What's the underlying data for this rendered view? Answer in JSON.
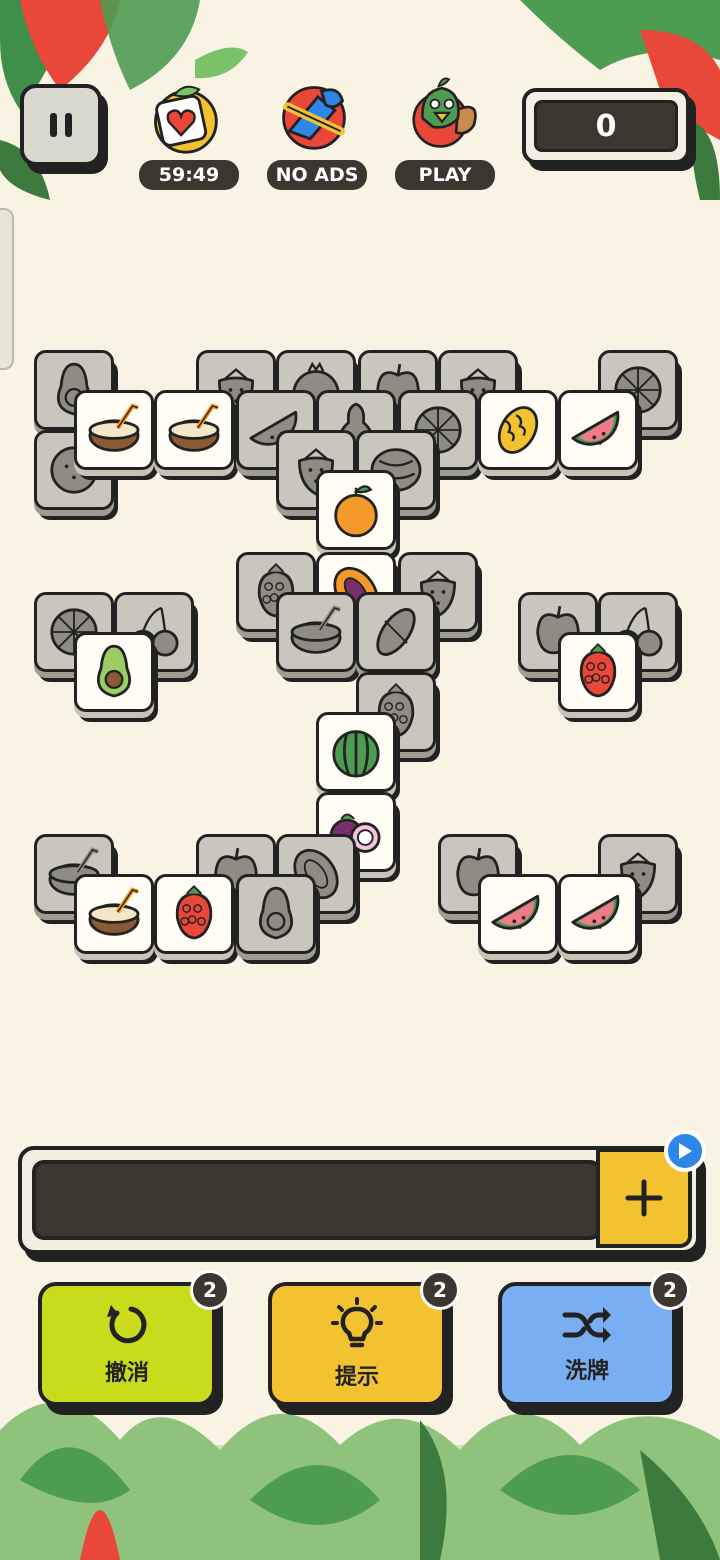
{
  "hud": {
    "timer": "59:49",
    "no_ads": "NO ADS",
    "play": "PLAY",
    "score": "0"
  },
  "tiles": [
    {
      "fruit": "avocado",
      "dim": true
    },
    {
      "fruit": "strawberry",
      "dim": true
    },
    {
      "fruit": "pomegranate",
      "dim": true
    },
    {
      "fruit": "apple",
      "dim": true
    },
    {
      "fruit": "strawberry",
      "dim": true
    },
    {
      "fruit": "orange",
      "dim": true
    },
    {
      "fruit": "kiwi",
      "dim": true
    },
    {
      "fruit": "coconut",
      "dim": false
    },
    {
      "fruit": "coconut",
      "dim": false
    },
    {
      "fruit": "watermelon",
      "dim": true
    },
    {
      "fruit": "pear",
      "dim": true
    },
    {
      "fruit": "orange",
      "dim": true
    },
    {
      "fruit": "melon",
      "dim": false
    },
    {
      "fruit": "watermelon",
      "dim": false
    },
    {
      "fruit": "strawberry",
      "dim": true
    },
    {
      "fruit": "watermelon-whole",
      "dim": true
    },
    {
      "fruit": "tangerine",
      "dim": false
    },
    {
      "fruit": "raspberry",
      "dim": true
    },
    {
      "fruit": "strawberry",
      "dim": true
    },
    {
      "fruit": "papaya",
      "dim": false
    },
    {
      "fruit": "orange",
      "dim": true
    },
    {
      "fruit": "cherry",
      "dim": true
    },
    {
      "fruit": "avocado",
      "dim": false
    },
    {
      "fruit": "apple",
      "dim": true
    },
    {
      "fruit": "cherry",
      "dim": true
    },
    {
      "fruit": "raspberry",
      "dim": false
    },
    {
      "fruit": "coconut",
      "dim": true
    },
    {
      "fruit": "cacao",
      "dim": true
    },
    {
      "fruit": "raspberry",
      "dim": true
    },
    {
      "fruit": "green-melon",
      "dim": false
    },
    {
      "fruit": "mangosteen",
      "dim": false
    },
    {
      "fruit": "coconut",
      "dim": true
    },
    {
      "fruit": "apple",
      "dim": true
    },
    {
      "fruit": "papaya",
      "dim": true
    },
    {
      "fruit": "apple",
      "dim": true
    },
    {
      "fruit": "strawberry",
      "dim": true
    },
    {
      "fruit": "coconut",
      "dim": false
    },
    {
      "fruit": "raspberry",
      "dim": false
    },
    {
      "fruit": "avocado",
      "dim": true
    },
    {
      "fruit": "watermelon",
      "dim": false
    },
    {
      "fruit": "watermelon",
      "dim": false
    }
  ],
  "actions": {
    "undo": {
      "label": "撤消",
      "count": "2"
    },
    "hint": {
      "label": "提示",
      "count": "2"
    },
    "shuffle": {
      "label": "洗牌",
      "count": "2"
    }
  },
  "colors": {
    "background": "#f9f3e3",
    "undo": "#c8dc1c",
    "hint": "#f2c231",
    "shuffle": "#7aaef2",
    "accent": "#2d86e8"
  }
}
